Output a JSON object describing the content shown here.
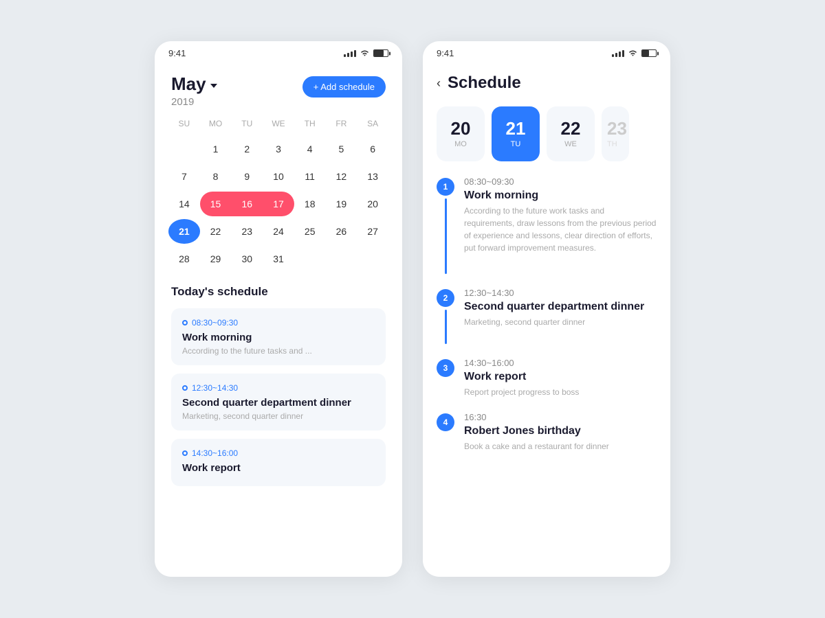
{
  "left_phone": {
    "status_time": "9:41",
    "month": "May",
    "year": "2019",
    "add_schedule_label": "+ Add schedule",
    "weekdays": [
      "SU",
      "MO",
      "TU",
      "WE",
      "TH",
      "FR",
      "SA"
    ],
    "days": [
      {
        "num": "",
        "type": "empty"
      },
      {
        "num": "1",
        "type": "normal"
      },
      {
        "num": "2",
        "type": "normal"
      },
      {
        "num": "3",
        "type": "normal"
      },
      {
        "num": "4",
        "type": "normal"
      },
      {
        "num": "5",
        "type": "normal"
      },
      {
        "num": "6",
        "type": "normal"
      },
      {
        "num": "7",
        "type": "normal"
      },
      {
        "num": "8",
        "type": "normal"
      },
      {
        "num": "9",
        "type": "normal"
      },
      {
        "num": "10",
        "type": "normal"
      },
      {
        "num": "11",
        "type": "normal"
      },
      {
        "num": "12",
        "type": "normal"
      },
      {
        "num": "13",
        "type": "normal"
      },
      {
        "num": "14",
        "type": "normal"
      },
      {
        "num": "15",
        "type": "highlight-start"
      },
      {
        "num": "16",
        "type": "highlight-mid"
      },
      {
        "num": "17",
        "type": "highlight-end"
      },
      {
        "num": "18",
        "type": "normal"
      },
      {
        "num": "19",
        "type": "normal"
      },
      {
        "num": "20",
        "type": "normal"
      },
      {
        "num": "21",
        "type": "today"
      },
      {
        "num": "22",
        "type": "normal"
      },
      {
        "num": "23",
        "type": "normal"
      },
      {
        "num": "24",
        "type": "normal"
      },
      {
        "num": "25",
        "type": "normal"
      },
      {
        "num": "26",
        "type": "normal"
      },
      {
        "num": "27",
        "type": "normal"
      },
      {
        "num": "28",
        "type": "normal"
      },
      {
        "num": "29",
        "type": "normal"
      },
      {
        "num": "30",
        "type": "normal"
      },
      {
        "num": "31",
        "type": "normal"
      }
    ],
    "schedule_section_title": "Today's schedule",
    "schedule_cards": [
      {
        "time": "08:30~09:30",
        "title": "Work morning",
        "desc": "According to the future tasks and ..."
      },
      {
        "time": "12:30~14:30",
        "title": "Second quarter department dinner",
        "desc": "Marketing, second quarter dinner"
      },
      {
        "time": "14:30~16:00",
        "title": "Work report",
        "desc": ""
      }
    ]
  },
  "right_phone": {
    "status_time": "9:41",
    "page_title": "Schedule",
    "dates": [
      {
        "num": "20",
        "day": "MO",
        "active": false
      },
      {
        "num": "21",
        "day": "TU",
        "active": true
      },
      {
        "num": "22",
        "day": "WE",
        "active": false
      },
      {
        "num": "23",
        "day": "TH",
        "active": false,
        "partial": true
      }
    ],
    "events": [
      {
        "number": "1",
        "time": "08:30~09:30",
        "title": "Work morning",
        "desc": "According to the future work tasks and requirements, draw lessons from the previous period of experience and lessons, clear direction of efforts, put forward improvement measures.",
        "has_connector": true,
        "connector_height": "0"
      },
      {
        "number": "2",
        "time": "12:30~14:30",
        "title": "Second quarter department dinner",
        "desc": "Marketing, second quarter dinner",
        "has_connector": true,
        "connector_height": "0"
      },
      {
        "number": "3",
        "time": "14:30~16:00",
        "title": "Work report",
        "desc": "Report project progress to boss",
        "has_connector": false
      },
      {
        "number": "4",
        "time": "16:30",
        "title": "Robert Jones birthday",
        "desc": "Book a cake and a restaurant for dinner",
        "has_connector": false
      }
    ]
  }
}
